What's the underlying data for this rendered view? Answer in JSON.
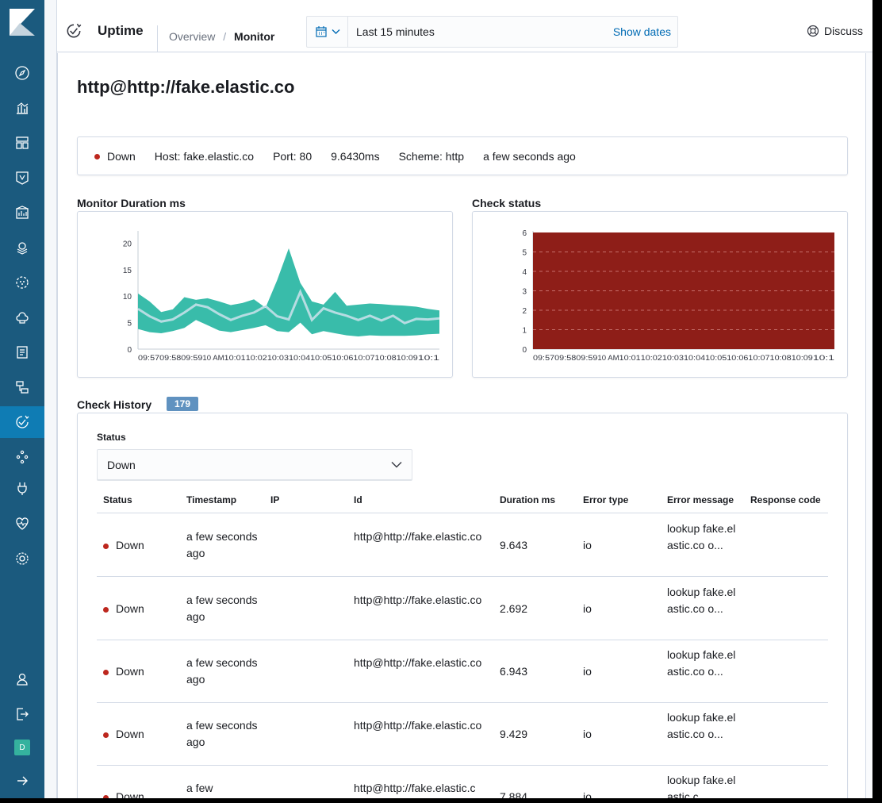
{
  "header": {
    "app_title": "Uptime",
    "breadcrumbs": [
      "Overview",
      "Monitor"
    ],
    "date_range": "Last 15 minutes",
    "show_dates": "Show dates",
    "discuss": "Discuss"
  },
  "sidebar": {
    "icons": [
      "discover-icon",
      "visualize-icon",
      "dashboard-icon",
      "canvas-icon",
      "maps-icon",
      "ml-icon",
      "infrastructure-icon",
      "logs-icon",
      "apm-icon",
      "uptime-icon",
      "graph-icon",
      "dev-tools-icon",
      "monitoring-icon",
      "management-icon",
      "user-icon",
      "logout-icon",
      "collapse-icon"
    ],
    "user_initial": "D"
  },
  "monitor": {
    "title": "http@http://fake.elastic.co",
    "status": "Down",
    "host": "Host: fake.elastic.co",
    "port": "Port: 80",
    "duration": "9.6430ms",
    "scheme": "Scheme: http",
    "time_ago": "a few seconds ago"
  },
  "duration_chart_title": "Monitor Duration ms",
  "status_chart_title": "Check status",
  "chart_data": [
    {
      "type": "area",
      "title": "Monitor Duration ms",
      "xlabel": "",
      "ylabel": "",
      "ylim": [
        0,
        22
      ],
      "yticks": [
        0,
        5,
        10,
        15,
        20
      ],
      "xticks": [
        "09:57",
        "09:58",
        "09:59",
        "10 AM",
        "10:01",
        "10:02",
        "10:03",
        "10:04",
        "10:05",
        "10:06",
        "10:07",
        "10:08",
        "10:09",
        "10:1"
      ],
      "x": [
        0,
        0.5,
        1,
        1.5,
        2,
        2.5,
        3,
        3.5,
        4,
        4.5,
        5,
        5.5,
        6,
        6.5,
        7,
        7.5,
        8,
        8.5,
        9,
        9.5,
        10,
        10.5,
        11,
        11.5,
        12,
        12.5,
        13
      ],
      "series": [
        {
          "role": "max",
          "values": [
            10.5,
            9,
            7,
            7.5,
            9.8,
            9.3,
            9.6,
            9,
            8.3,
            8.7,
            9.4,
            7.8,
            13,
            19,
            12.5,
            9,
            8.4,
            10.8,
            8.2,
            8.4,
            8.6,
            8.5,
            8.3,
            8.2,
            8.0,
            7.6,
            7.3
          ]
        },
        {
          "role": "avg",
          "values": [
            7.6,
            6.2,
            5.2,
            5.6,
            6.9,
            8.4,
            7.9,
            6.6,
            5.5,
            6.3,
            6.9,
            8.1,
            6.2,
            5.6,
            10.8,
            5.5,
            7.7,
            6.9,
            6.3,
            5.5,
            6.3,
            5.4,
            6.3,
            4.9,
            5.7,
            5.6,
            5.8
          ]
        },
        {
          "role": "min",
          "values": [
            3.8,
            3.2,
            3.0,
            3.4,
            4.0,
            5.5,
            4.5,
            3.5,
            3.2,
            3.6,
            4.0,
            4.5,
            3.4,
            3.2,
            5.0,
            2.8,
            3.4,
            3.0,
            2.6,
            2.4,
            2.6,
            2.5,
            2.5,
            2.5,
            2.6,
            2.8,
            2.9
          ]
        }
      ],
      "colors": {
        "band": "#2eb8a5",
        "avg": "#b9d8e5"
      }
    },
    {
      "type": "area",
      "title": "Check status",
      "ylim": [
        0,
        6
      ],
      "yticks": [
        0,
        1,
        2,
        3,
        4,
        5,
        6
      ],
      "xticks": [
        "09:57",
        "09:58",
        "09:59",
        "10 AM",
        "10:01",
        "10:02",
        "10:03",
        "10:04",
        "10:05",
        "10:06",
        "10:07",
        "10:08",
        "10:09",
        "10:1"
      ],
      "series": [
        {
          "name": "Down",
          "values": [
            6,
            6,
            6,
            6,
            6,
            6,
            6,
            6,
            6,
            6,
            6,
            6,
            6,
            6,
            6,
            6
          ]
        }
      ],
      "colors": {
        "down": "#8e1e18"
      }
    }
  ],
  "history": {
    "title": "Check History",
    "count": "179",
    "filter_label": "Status",
    "filter_value": "Down",
    "columns": [
      "Status",
      "Timestamp",
      "IP",
      "Id",
      "Duration ms",
      "Error type",
      "Error message",
      "Response code"
    ],
    "rows": [
      {
        "status": "Down",
        "timestamp": "a few seconds ago",
        "id": "http@http://fake.elastic.co",
        "duration": "9.643",
        "error_type": "io",
        "error_message": "lookup fake.elastic.co o..."
      },
      {
        "status": "Down",
        "timestamp": "a few seconds ago",
        "id": "http@http://fake.elastic.co",
        "duration": "2.692",
        "error_type": "io",
        "error_message": "lookup fake.elastic.co o..."
      },
      {
        "status": "Down",
        "timestamp": "a few seconds ago",
        "id": "http@http://fake.elastic.co",
        "duration": "6.943",
        "error_type": "io",
        "error_message": "lookup fake.elastic.co o..."
      },
      {
        "status": "Down",
        "timestamp": "a few seconds ago",
        "id": "http@http://fake.elastic.co",
        "duration": "9.429",
        "error_type": "io",
        "error_message": "lookup fake.elastic.co o..."
      },
      {
        "status": "Down",
        "timestamp": "a few",
        "id": "http@http://fake.elastic.c",
        "duration": "7.884",
        "error_type": "io",
        "error_message": "lookup fake.elastic.c"
      }
    ]
  }
}
